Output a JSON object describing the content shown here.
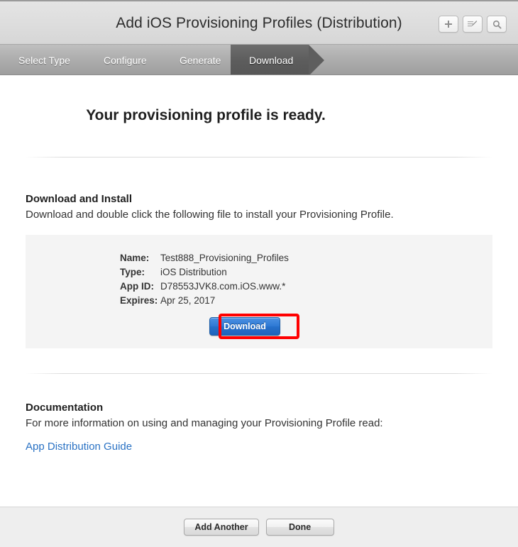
{
  "titlebar": {
    "title": "Add iOS Provisioning Profiles (Distribution)",
    "actions": [
      {
        "name": "add-button",
        "icon": "plus-icon",
        "label": "+"
      },
      {
        "name": "edit-button",
        "icon": "edit-pencil-icon",
        "label": ""
      },
      {
        "name": "search-button",
        "icon": "search-icon",
        "label": ""
      }
    ]
  },
  "steps": [
    {
      "label": "Select Type",
      "state": "done"
    },
    {
      "label": "Configure",
      "state": "done"
    },
    {
      "label": "Generate",
      "state": "done"
    },
    {
      "label": "Download",
      "state": "active"
    }
  ],
  "main": {
    "headline": "Your provisioning profile is ready.",
    "install": {
      "title": "Download and Install",
      "body": "Download and double click the following file to install your Provisioning Profile."
    },
    "profile": {
      "rows": [
        {
          "label": "Name:",
          "value": "Test888_Provisioning_Profiles"
        },
        {
          "label": "Type:",
          "value": "iOS Distribution"
        },
        {
          "label": "App ID:",
          "value": "D78553JVK8.com.iOS.www.*"
        },
        {
          "label": "Expires:",
          "value": "Apr 25, 2017"
        }
      ],
      "download_label": "Download"
    },
    "documentation": {
      "title": "Documentation",
      "body": "For more information on using and managing your Provisioning Profile read:",
      "link": "App Distribution Guide"
    }
  },
  "footer": {
    "add_another_label": "Add Another",
    "done_label": "Done"
  },
  "colors": {
    "accent_blue": "#2f7ad5",
    "link_blue": "#2a72c4",
    "annotation_red": "#ff0000",
    "panel_gray": "#f4f4f4",
    "nav_gray": "#b0b0b0",
    "nav_active_gray": "#5d5d5d"
  }
}
